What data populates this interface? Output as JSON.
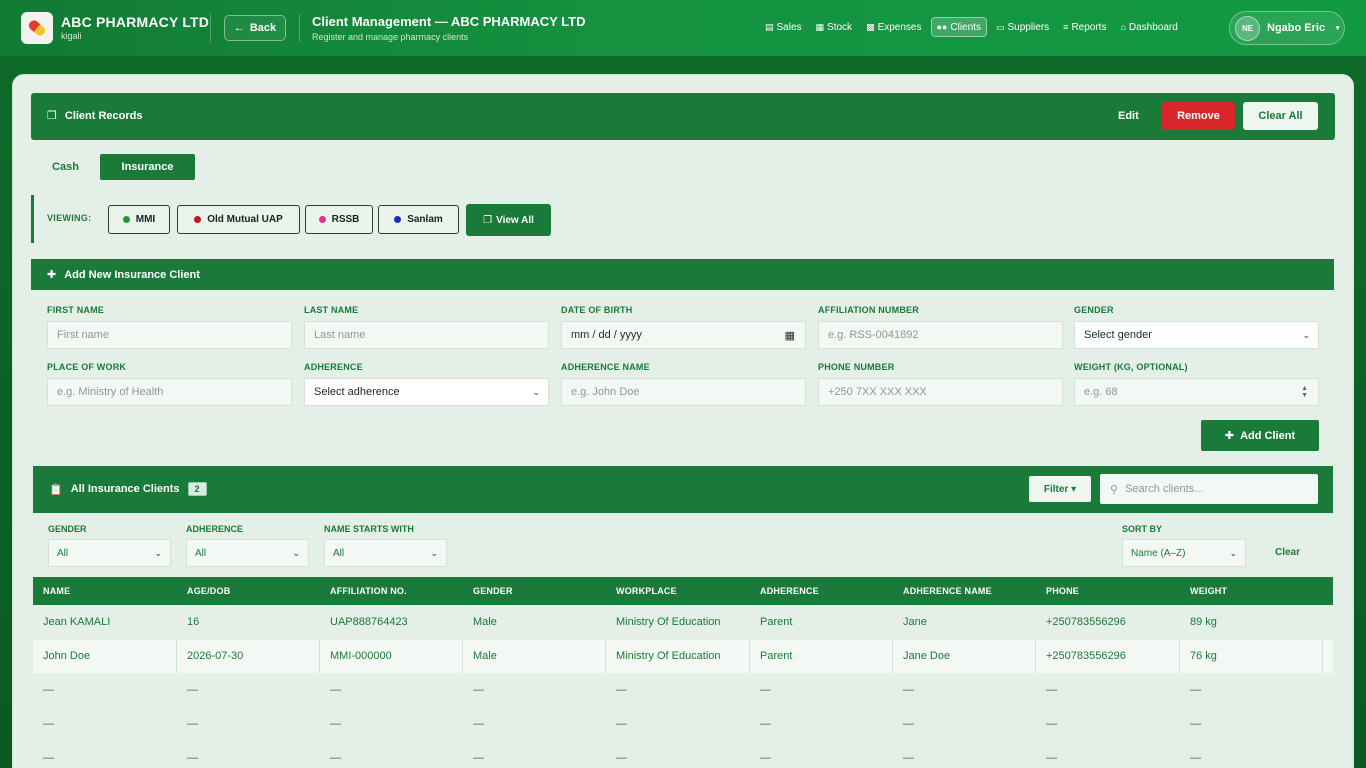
{
  "brand": {
    "name": "ABC PHARMACY LTD",
    "location": "kigali"
  },
  "back_label": "Back",
  "header": {
    "title": "Client Management — ABC PHARMACY LTD",
    "subtitle": "Register and manage pharmacy clients"
  },
  "nav": [
    {
      "label": "Sales",
      "icon": "register-icon"
    },
    {
      "label": "Stock",
      "icon": "boxes-icon"
    },
    {
      "label": "Expenses",
      "icon": "receipt-icon"
    },
    {
      "label": "Clients",
      "icon": "users-icon",
      "active": true
    },
    {
      "label": "Suppliers",
      "icon": "factory-icon"
    },
    {
      "label": "Reports",
      "icon": "list-icon"
    },
    {
      "label": "Dashboard",
      "icon": "home-icon"
    }
  ],
  "user": {
    "initials": "NE",
    "name": "Ngabo Eric"
  },
  "records": {
    "title": "Client Records",
    "edit_label": "Edit",
    "remove_label": "Remove",
    "clear_all_label": "Clear All"
  },
  "tabs": {
    "cash": "Cash",
    "insurance": "Insurance"
  },
  "viewing": {
    "label": "VIEWING:",
    "insurers": [
      {
        "name": "MMI",
        "color": "#1e9a3c"
      },
      {
        "name": "Old Mutual UAP",
        "color": "#c0161c"
      },
      {
        "name": "RSSB",
        "color": "#e0338a"
      },
      {
        "name": "Sanlam",
        "color": "#1a2ab8"
      }
    ],
    "view_all_label": "View All"
  },
  "add_form": {
    "title": "Add New Insurance Client",
    "fields": {
      "first_name": {
        "label": "FIRST NAME",
        "placeholder": "First name"
      },
      "last_name": {
        "label": "LAST NAME",
        "placeholder": "Last name"
      },
      "dob": {
        "label": "DATE OF BIRTH",
        "value": "mm / dd / yyyy"
      },
      "affiliation": {
        "label": "AFFILIATION NUMBER",
        "placeholder": "e.g. RSS-0041892"
      },
      "gender": {
        "label": "GENDER",
        "value": "Select gender"
      },
      "workplace": {
        "label": "PLACE OF WORK",
        "placeholder": "e.g. Ministry of Health"
      },
      "adherence": {
        "label": "ADHERENCE",
        "value": "Select adherence"
      },
      "adherence_name": {
        "label": "ADHERENCE NAME",
        "placeholder": "e.g. John Doe"
      },
      "phone": {
        "label": "PHONE NUMBER",
        "placeholder": "+250 7XX XXX XXX"
      },
      "weight": {
        "label": "WEIGHT (KG, OPTIONAL)",
        "placeholder": "e.g. 68"
      }
    },
    "submit_label": "Add Client"
  },
  "list": {
    "title": "All Insurance Clients",
    "count": "2",
    "filter_label": "Filter ▾",
    "search_placeholder": "Search clients...",
    "filters": {
      "gender": {
        "label": "GENDER",
        "value": "All"
      },
      "adherence": {
        "label": "ADHERENCE",
        "value": "All"
      },
      "name_starts": {
        "label": "NAME STARTS WITH",
        "value": "All"
      },
      "sort": {
        "label": "SORT BY",
        "value": "Name (A–Z)"
      },
      "clear_label": "Clear"
    },
    "columns": [
      "NAME",
      "AGE/DOB",
      "AFFILIATION NO.",
      "GENDER",
      "WORKPLACE",
      "ADHERENCE",
      "ADHERENCE NAME",
      "PHONE",
      "WEIGHT"
    ],
    "rows": [
      [
        "Jean KAMALI",
        "16",
        "UAP888764423",
        "Male",
        "Ministry Of Education",
        "Parent",
        "Jane",
        "+250783556296",
        "89 kg"
      ],
      [
        "John Doe",
        "2026-07-30",
        "MMI-000000",
        "Male",
        "Ministry Of Education",
        "Parent",
        "Jane Doe",
        "+250783556296",
        "76 kg"
      ],
      [
        "—",
        "—",
        "—",
        "—",
        "—",
        "—",
        "—",
        "—",
        "—"
      ],
      [
        "—",
        "—",
        "—",
        "—",
        "—",
        "—",
        "—",
        "—",
        "—"
      ],
      [
        "—",
        "—",
        "—",
        "—",
        "—",
        "—",
        "—",
        "—",
        "—"
      ]
    ]
  }
}
